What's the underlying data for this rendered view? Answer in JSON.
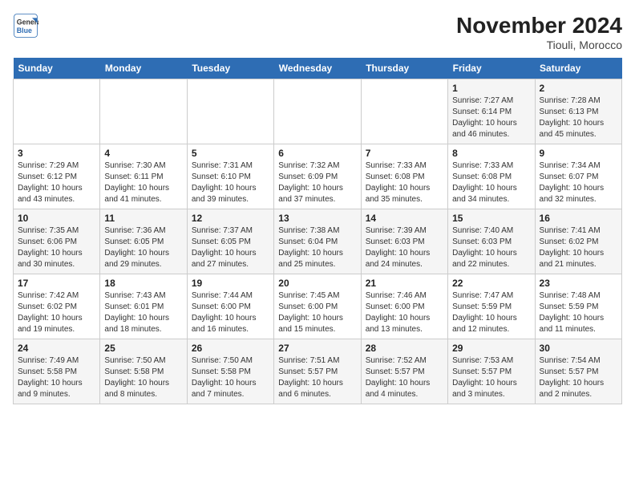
{
  "header": {
    "logo_line1": "General",
    "logo_line2": "Blue",
    "title": "November 2024",
    "subtitle": "Tiouli, Morocco"
  },
  "weekdays": [
    "Sunday",
    "Monday",
    "Tuesday",
    "Wednesday",
    "Thursday",
    "Friday",
    "Saturday"
  ],
  "weeks": [
    [
      {
        "day": "",
        "info": ""
      },
      {
        "day": "",
        "info": ""
      },
      {
        "day": "",
        "info": ""
      },
      {
        "day": "",
        "info": ""
      },
      {
        "day": "",
        "info": ""
      },
      {
        "day": "1",
        "info": "Sunrise: 7:27 AM\nSunset: 6:14 PM\nDaylight: 10 hours and 46 minutes."
      },
      {
        "day": "2",
        "info": "Sunrise: 7:28 AM\nSunset: 6:13 PM\nDaylight: 10 hours and 45 minutes."
      }
    ],
    [
      {
        "day": "3",
        "info": "Sunrise: 7:29 AM\nSunset: 6:12 PM\nDaylight: 10 hours and 43 minutes."
      },
      {
        "day": "4",
        "info": "Sunrise: 7:30 AM\nSunset: 6:11 PM\nDaylight: 10 hours and 41 minutes."
      },
      {
        "day": "5",
        "info": "Sunrise: 7:31 AM\nSunset: 6:10 PM\nDaylight: 10 hours and 39 minutes."
      },
      {
        "day": "6",
        "info": "Sunrise: 7:32 AM\nSunset: 6:09 PM\nDaylight: 10 hours and 37 minutes."
      },
      {
        "day": "7",
        "info": "Sunrise: 7:33 AM\nSunset: 6:08 PM\nDaylight: 10 hours and 35 minutes."
      },
      {
        "day": "8",
        "info": "Sunrise: 7:33 AM\nSunset: 6:08 PM\nDaylight: 10 hours and 34 minutes."
      },
      {
        "day": "9",
        "info": "Sunrise: 7:34 AM\nSunset: 6:07 PM\nDaylight: 10 hours and 32 minutes."
      }
    ],
    [
      {
        "day": "10",
        "info": "Sunrise: 7:35 AM\nSunset: 6:06 PM\nDaylight: 10 hours and 30 minutes."
      },
      {
        "day": "11",
        "info": "Sunrise: 7:36 AM\nSunset: 6:05 PM\nDaylight: 10 hours and 29 minutes."
      },
      {
        "day": "12",
        "info": "Sunrise: 7:37 AM\nSunset: 6:05 PM\nDaylight: 10 hours and 27 minutes."
      },
      {
        "day": "13",
        "info": "Sunrise: 7:38 AM\nSunset: 6:04 PM\nDaylight: 10 hours and 25 minutes."
      },
      {
        "day": "14",
        "info": "Sunrise: 7:39 AM\nSunset: 6:03 PM\nDaylight: 10 hours and 24 minutes."
      },
      {
        "day": "15",
        "info": "Sunrise: 7:40 AM\nSunset: 6:03 PM\nDaylight: 10 hours and 22 minutes."
      },
      {
        "day": "16",
        "info": "Sunrise: 7:41 AM\nSunset: 6:02 PM\nDaylight: 10 hours and 21 minutes."
      }
    ],
    [
      {
        "day": "17",
        "info": "Sunrise: 7:42 AM\nSunset: 6:02 PM\nDaylight: 10 hours and 19 minutes."
      },
      {
        "day": "18",
        "info": "Sunrise: 7:43 AM\nSunset: 6:01 PM\nDaylight: 10 hours and 18 minutes."
      },
      {
        "day": "19",
        "info": "Sunrise: 7:44 AM\nSunset: 6:00 PM\nDaylight: 10 hours and 16 minutes."
      },
      {
        "day": "20",
        "info": "Sunrise: 7:45 AM\nSunset: 6:00 PM\nDaylight: 10 hours and 15 minutes."
      },
      {
        "day": "21",
        "info": "Sunrise: 7:46 AM\nSunset: 6:00 PM\nDaylight: 10 hours and 13 minutes."
      },
      {
        "day": "22",
        "info": "Sunrise: 7:47 AM\nSunset: 5:59 PM\nDaylight: 10 hours and 12 minutes."
      },
      {
        "day": "23",
        "info": "Sunrise: 7:48 AM\nSunset: 5:59 PM\nDaylight: 10 hours and 11 minutes."
      }
    ],
    [
      {
        "day": "24",
        "info": "Sunrise: 7:49 AM\nSunset: 5:58 PM\nDaylight: 10 hours and 9 minutes."
      },
      {
        "day": "25",
        "info": "Sunrise: 7:50 AM\nSunset: 5:58 PM\nDaylight: 10 hours and 8 minutes."
      },
      {
        "day": "26",
        "info": "Sunrise: 7:50 AM\nSunset: 5:58 PM\nDaylight: 10 hours and 7 minutes."
      },
      {
        "day": "27",
        "info": "Sunrise: 7:51 AM\nSunset: 5:57 PM\nDaylight: 10 hours and 6 minutes."
      },
      {
        "day": "28",
        "info": "Sunrise: 7:52 AM\nSunset: 5:57 PM\nDaylight: 10 hours and 4 minutes."
      },
      {
        "day": "29",
        "info": "Sunrise: 7:53 AM\nSunset: 5:57 PM\nDaylight: 10 hours and 3 minutes."
      },
      {
        "day": "30",
        "info": "Sunrise: 7:54 AM\nSunset: 5:57 PM\nDaylight: 10 hours and 2 minutes."
      }
    ]
  ]
}
